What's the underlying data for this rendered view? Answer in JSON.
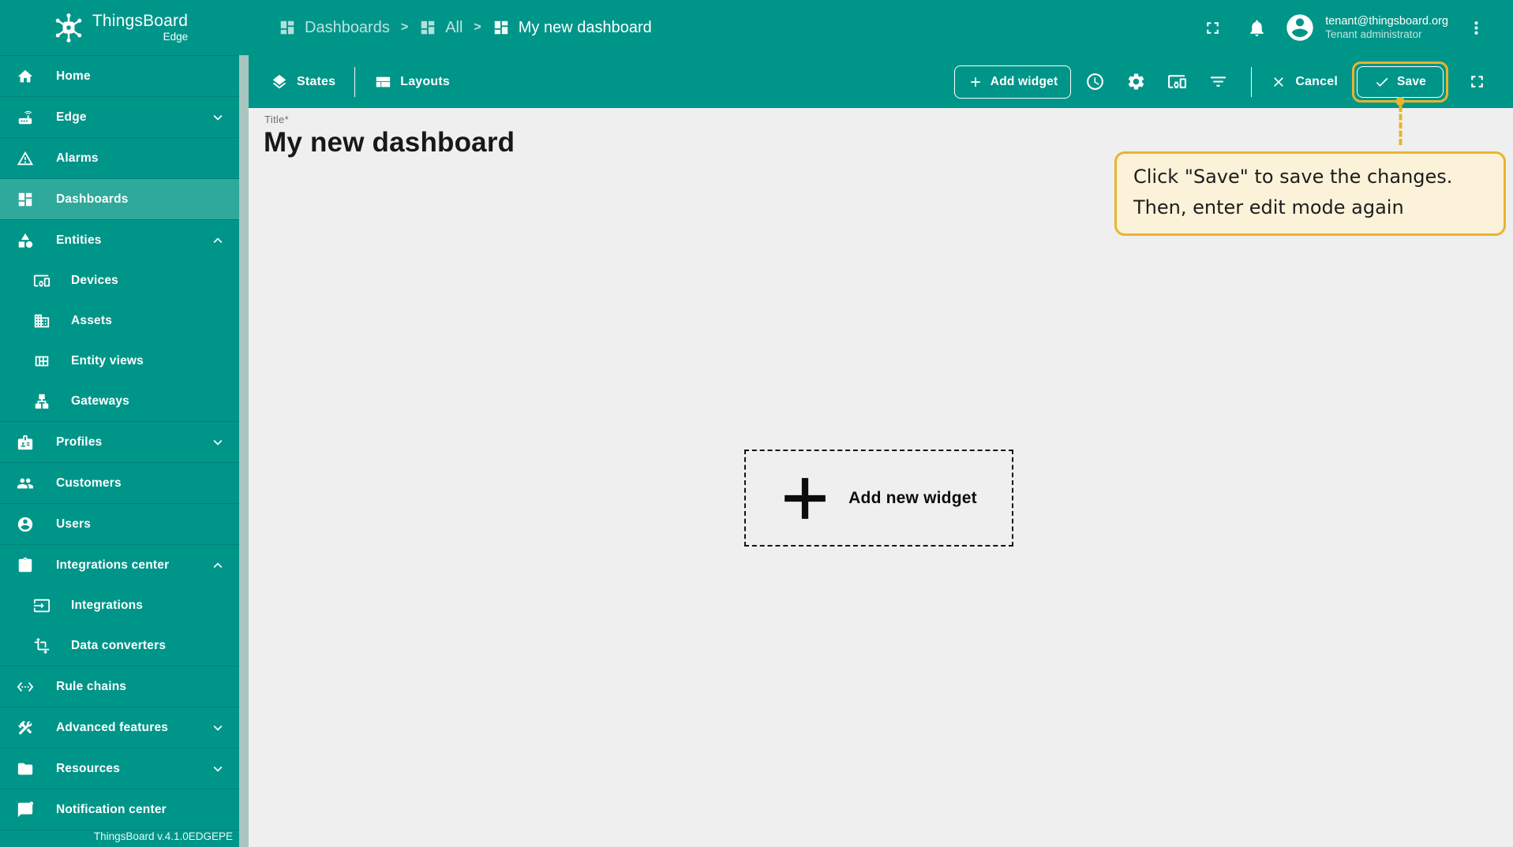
{
  "header": {
    "logo": {
      "title": "ThingsBoard",
      "subtitle": "Edge"
    },
    "breadcrumb_separator": ">",
    "breadcrumbs": [
      {
        "label": "Dashboards",
        "icon": "dashboard",
        "current": false
      },
      {
        "label": "All",
        "icon": "dashboard",
        "current": false
      },
      {
        "label": "My new dashboard",
        "icon": "dashboard",
        "current": true
      }
    ],
    "actions": [
      {
        "name": "fullscreen",
        "icon": "fullscreen-icon"
      },
      {
        "name": "notifications",
        "icon": "bell-icon"
      }
    ],
    "user": {
      "email": "tenant@thingsboard.org",
      "role": "Tenant administrator"
    }
  },
  "sidebar": {
    "items": [
      {
        "label": "Home",
        "icon": "home",
        "selected": false,
        "chevron": null
      },
      {
        "label": "Edge",
        "icon": "router",
        "selected": false,
        "chevron": "down"
      },
      {
        "label": "Alarms",
        "icon": "warning",
        "selected": false,
        "chevron": null
      },
      {
        "label": "Dashboards",
        "icon": "dashboard",
        "selected": true,
        "chevron": null
      },
      {
        "label": "Entities",
        "icon": "category",
        "selected": false,
        "chevron": "up",
        "children": [
          {
            "label": "Devices",
            "icon": "devices"
          },
          {
            "label": "Assets",
            "icon": "domain"
          },
          {
            "label": "Entity views",
            "icon": "view_quilt"
          },
          {
            "label": "Gateways",
            "icon": "lan"
          }
        ]
      },
      {
        "label": "Profiles",
        "icon": "badge",
        "selected": false,
        "chevron": "down"
      },
      {
        "label": "Customers",
        "icon": "people",
        "selected": false,
        "chevron": null
      },
      {
        "label": "Users",
        "icon": "account",
        "selected": false,
        "chevron": null
      },
      {
        "label": "Integrations center",
        "icon": "integration",
        "selected": false,
        "chevron": "up",
        "children": [
          {
            "label": "Integrations",
            "icon": "input"
          },
          {
            "label": "Data converters",
            "icon": "transform"
          }
        ]
      },
      {
        "label": "Rule chains",
        "icon": "ethernet",
        "selected": false,
        "chevron": null
      },
      {
        "label": "Advanced features",
        "icon": "construction",
        "selected": false,
        "chevron": "down"
      },
      {
        "label": "Resources",
        "icon": "folder",
        "selected": false,
        "chevron": "down"
      },
      {
        "label": "Notification center",
        "icon": "notification",
        "selected": false,
        "chevron": null
      }
    ],
    "footer": "ThingsBoard v.4.1.0EDGEPE"
  },
  "toolbar": {
    "states_label": "States",
    "layouts_label": "Layouts",
    "add_widget_label": "Add widget",
    "icon_buttons": [
      "time-window-icon",
      "settings-icon",
      "entity-aliases-icon",
      "filters-icon"
    ],
    "cancel_label": "Cancel",
    "save_label": "Save"
  },
  "content": {
    "title_label": "Title*",
    "dashboard_title": "My new dashboard",
    "add_widget_placeholder": "Add new widget",
    "tooltip": {
      "line1": "Click \"Save\" to save the changes.",
      "line2": "Then, enter edit mode again"
    }
  },
  "colors": {
    "primary": "#009589",
    "primary_selected": "#2ea99a",
    "highlight_yellow": "#e9b42e",
    "tooltip_bg": "#fcf2d9",
    "content_bg": "#efefef",
    "scrollbar": "#a9c5c0"
  }
}
